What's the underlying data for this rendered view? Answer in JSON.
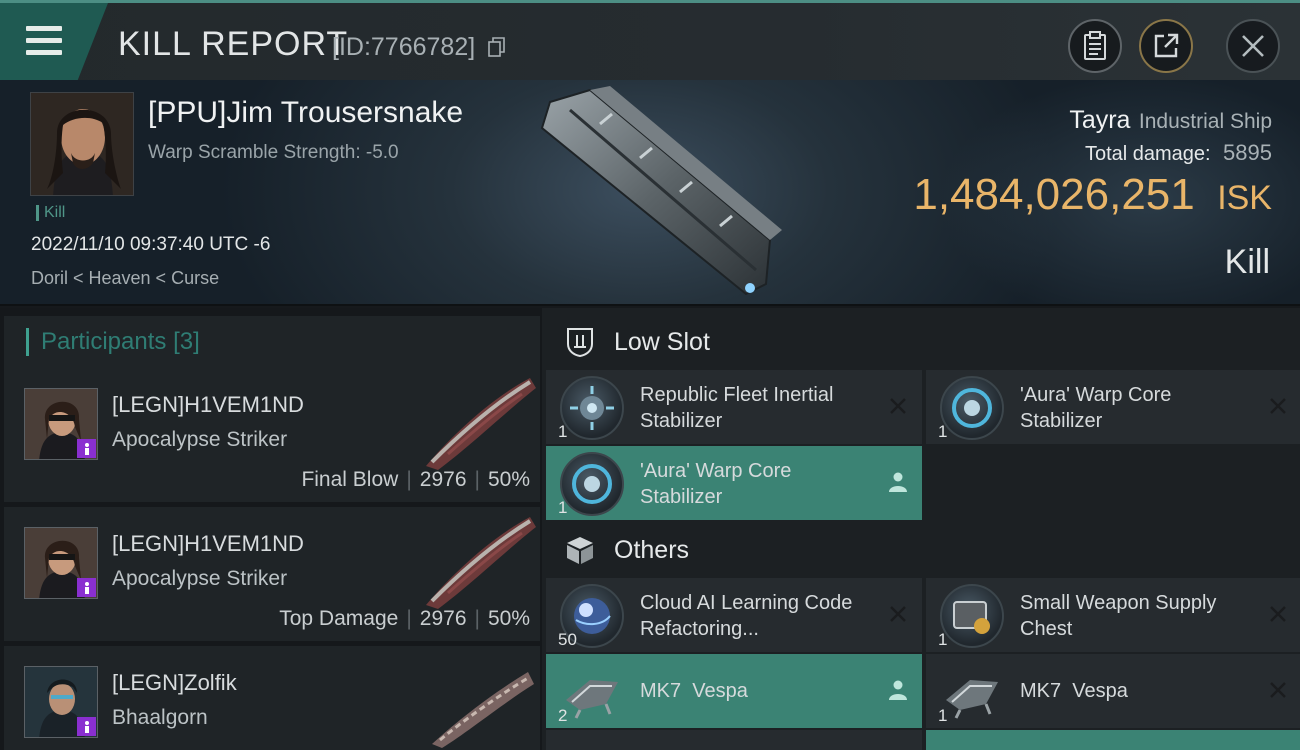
{
  "header": {
    "title": "KILL REPORT",
    "report_id": "[ID:7766782]",
    "buttons": [
      {
        "name": "clipboard-button",
        "icon": "clipboard-icon"
      },
      {
        "name": "share-button",
        "icon": "share-icon"
      },
      {
        "name": "close-button",
        "icon": "close-icon"
      }
    ]
  },
  "summary": {
    "pilot_name": "[PPU]Jim Trousersnake",
    "warp_scramble": "Warp Scramble Strength: -5.0",
    "kill_tag": "Kill",
    "date": "2022/11/10 09:37:40 UTC -6",
    "location": "Doril < Heaven < Curse",
    "ship_name": "Tayra",
    "ship_class": "Industrial Ship",
    "damage_label": "Total damage:",
    "damage_value": "5895",
    "isk_value": "1,484,026,251",
    "isk_unit": "ISK",
    "result_type": "Kill"
  },
  "participants": {
    "title": "Participants",
    "count": "[3]",
    "rows": [
      {
        "name": "[LEGN]H1VEM1ND",
        "ship": "Apocalypse Striker",
        "role": "Final Blow",
        "damage": "2976",
        "percent": "50%"
      },
      {
        "name": "[LEGN]H1VEM1ND",
        "ship": "Apocalypse Striker",
        "role": "Top Damage",
        "damage": "2976",
        "percent": "50%"
      },
      {
        "name": "[LEGN]Zolfik",
        "ship": "Bhaalgorn",
        "role": "",
        "damage": "",
        "percent": ""
      }
    ]
  },
  "low_slot": {
    "title": "Low Slot",
    "items": [
      {
        "name": "Republic Fleet Inertial Stabilizer",
        "qty": "1",
        "status": "destroyed"
      },
      {
        "name": "'Aura' Warp Core Stabilizer",
        "qty": "1",
        "status": "destroyed"
      },
      {
        "name": "'Aura' Warp Core Stabilizer",
        "qty": "1",
        "status": "dropped"
      }
    ]
  },
  "others": {
    "title": "Others",
    "items": [
      {
        "name": "Cloud AI Learning Code Refactoring...",
        "qty": "50",
        "status": "destroyed"
      },
      {
        "name": "Small Weapon Supply Chest",
        "qty": "1",
        "status": "destroyed"
      },
      {
        "name": "MK7  Vespa",
        "qty": "2",
        "status": "dropped"
      },
      {
        "name": "MK7  Vespa",
        "qty": "1",
        "status": "destroyed"
      }
    ]
  },
  "colors": {
    "accent": "#3b8374",
    "isk": "#e9b569",
    "dropped_bg": "#3b8374",
    "destroyed_bg": "#262b2f"
  }
}
